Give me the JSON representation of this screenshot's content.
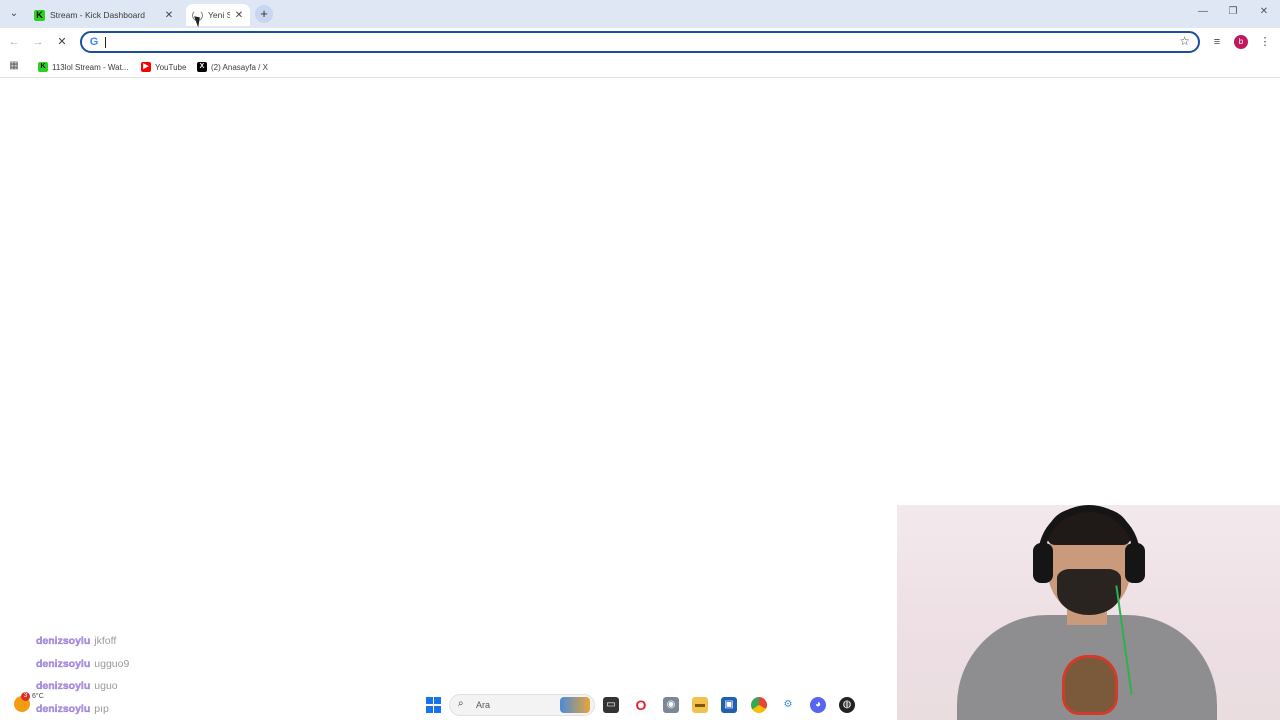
{
  "tabs": [
    {
      "title": "Stream - Kick Dashboard",
      "favicon": "kick-icon",
      "active": false
    },
    {
      "title": "Yeni S",
      "favicon": "loading-spinner-icon",
      "active": true
    }
  ],
  "omnibox": {
    "value": "",
    "placeholder": ""
  },
  "bookmarks": [
    {
      "label": "113lol Stream - Wat...",
      "icon": "kick-icon"
    },
    {
      "label": "YouTube",
      "icon": "youtube-icon"
    },
    {
      "label": "(2) Anasayfa / X",
      "icon": "x-icon"
    }
  ],
  "profile": {
    "initial": "b",
    "color": "#c2185b"
  },
  "chat": [
    {
      "user": "denizsoylu",
      "message": "jkfoff"
    },
    {
      "user": "denizsoylu",
      "message": "ugguo9"
    },
    {
      "user": "denizsoylu",
      "message": "uguo"
    },
    {
      "user": "denizsoylu",
      "message": "pıp"
    }
  ],
  "taskbar": {
    "search_label": "Ara",
    "weather_badge": "3",
    "weather_temp": "6°C"
  },
  "colors": {
    "accent": "#1a4fa0",
    "chat_user": "#b59ae8",
    "tabstrip": "#dfe6f4"
  }
}
